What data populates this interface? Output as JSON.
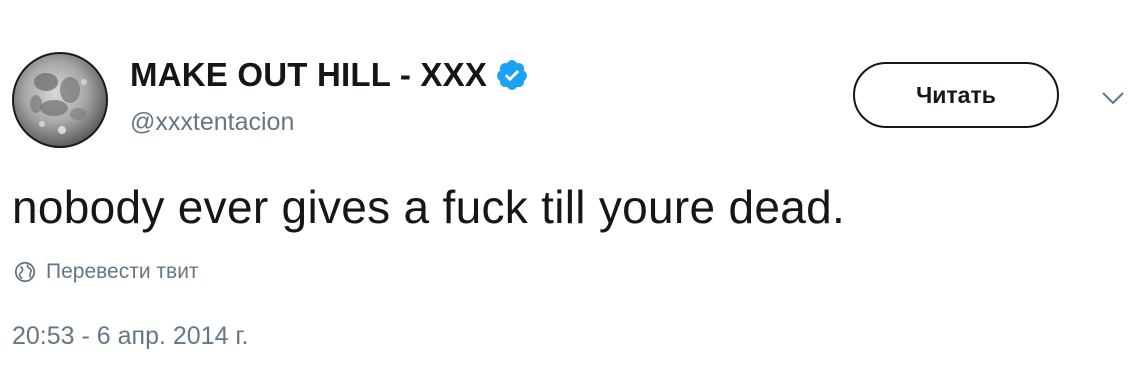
{
  "tweet": {
    "author": {
      "display_name": "MAKE OUT HILL - XXX",
      "handle": "@xxxtentacion",
      "avatar": "moon-avatar",
      "verified": true,
      "verified_icon": "verified-badge-icon"
    },
    "follow_button_label": "Читать",
    "menu_icon": "chevron-down-icon",
    "text": "nobody ever gives a fuck till youre dead.",
    "translate_label": "Перевести твит",
    "translate_icon": "globe-icon",
    "timestamp": "20:53 - 6 апр. 2014 г."
  },
  "colors": {
    "text_primary": "#14171a",
    "text_secondary": "#657786",
    "verified_blue": "#1da1f2",
    "background": "#ffffff"
  }
}
